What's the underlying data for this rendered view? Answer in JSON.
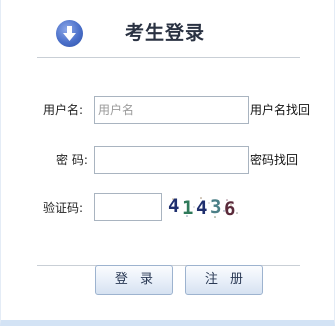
{
  "header": {
    "title": "考生登录",
    "icon": "download-arrow-icon"
  },
  "form": {
    "username": {
      "label": "用户名:",
      "placeholder": "用户名",
      "value": "",
      "recover_link": "用户名找回"
    },
    "password": {
      "label": "密 码:",
      "value": "",
      "recover_link": "密码找回"
    },
    "captcha": {
      "label": "验证码:",
      "value": "",
      "chars": [
        "4",
        "1",
        "4",
        "3",
        "6"
      ],
      "colors": [
        "#1f2f6e",
        "#2f7a5a",
        "#1f2f6e",
        "#4b7f86",
        "#5a2a3a"
      ]
    }
  },
  "buttons": {
    "login": "登 录",
    "register": "注 册"
  },
  "colors": {
    "accent": "#4a6fc9",
    "button_border": "#9db3cf",
    "divider": "#c9cfd6"
  }
}
